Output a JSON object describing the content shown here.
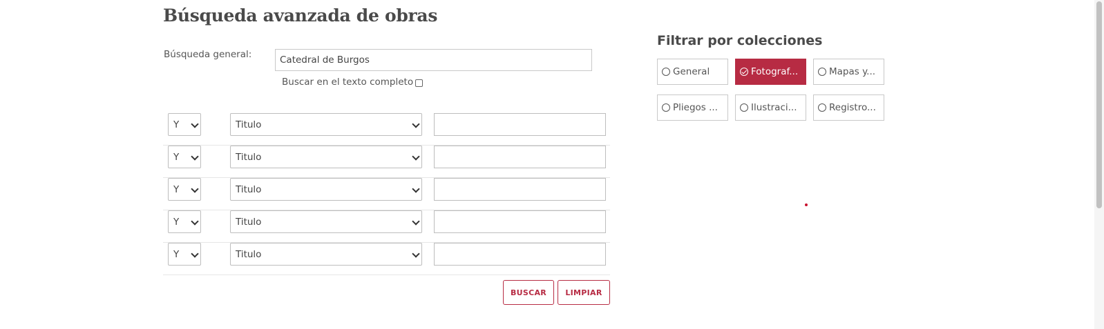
{
  "page": {
    "title": "Búsqueda avanzada de obras"
  },
  "search": {
    "general_label": "Búsqueda general:",
    "general_value": "Catedral de Burgos",
    "fulltext_label": "Buscar en el texto completo"
  },
  "rows": [
    {
      "operator": "Y",
      "field": "Titulo",
      "term": ""
    },
    {
      "operator": "Y",
      "field": "Titulo",
      "term": ""
    },
    {
      "operator": "Y",
      "field": "Titulo",
      "term": ""
    },
    {
      "operator": "Y",
      "field": "Titulo",
      "term": ""
    },
    {
      "operator": "Y",
      "field": "Titulo",
      "term": ""
    }
  ],
  "buttons": {
    "search": "BUSCAR",
    "clear": "LIMPIAR"
  },
  "filters": {
    "title": "Filtrar por colecciones",
    "collections": [
      {
        "label": "General",
        "selected": false
      },
      {
        "label": "Fotograf...",
        "selected": true
      },
      {
        "label": "Mapas y...",
        "selected": false
      },
      {
        "label": "Pliegos ...",
        "selected": false
      },
      {
        "label": "Ilustraci...",
        "selected": false
      },
      {
        "label": "Registro...",
        "selected": false
      }
    ]
  },
  "colors": {
    "accent": "#b72b43",
    "text": "#444444",
    "border": "#c8c8c8"
  },
  "icons": {
    "dropdown": "chevron-down-icon",
    "radio": "radio-icon",
    "checked": "check-circle-icon"
  }
}
